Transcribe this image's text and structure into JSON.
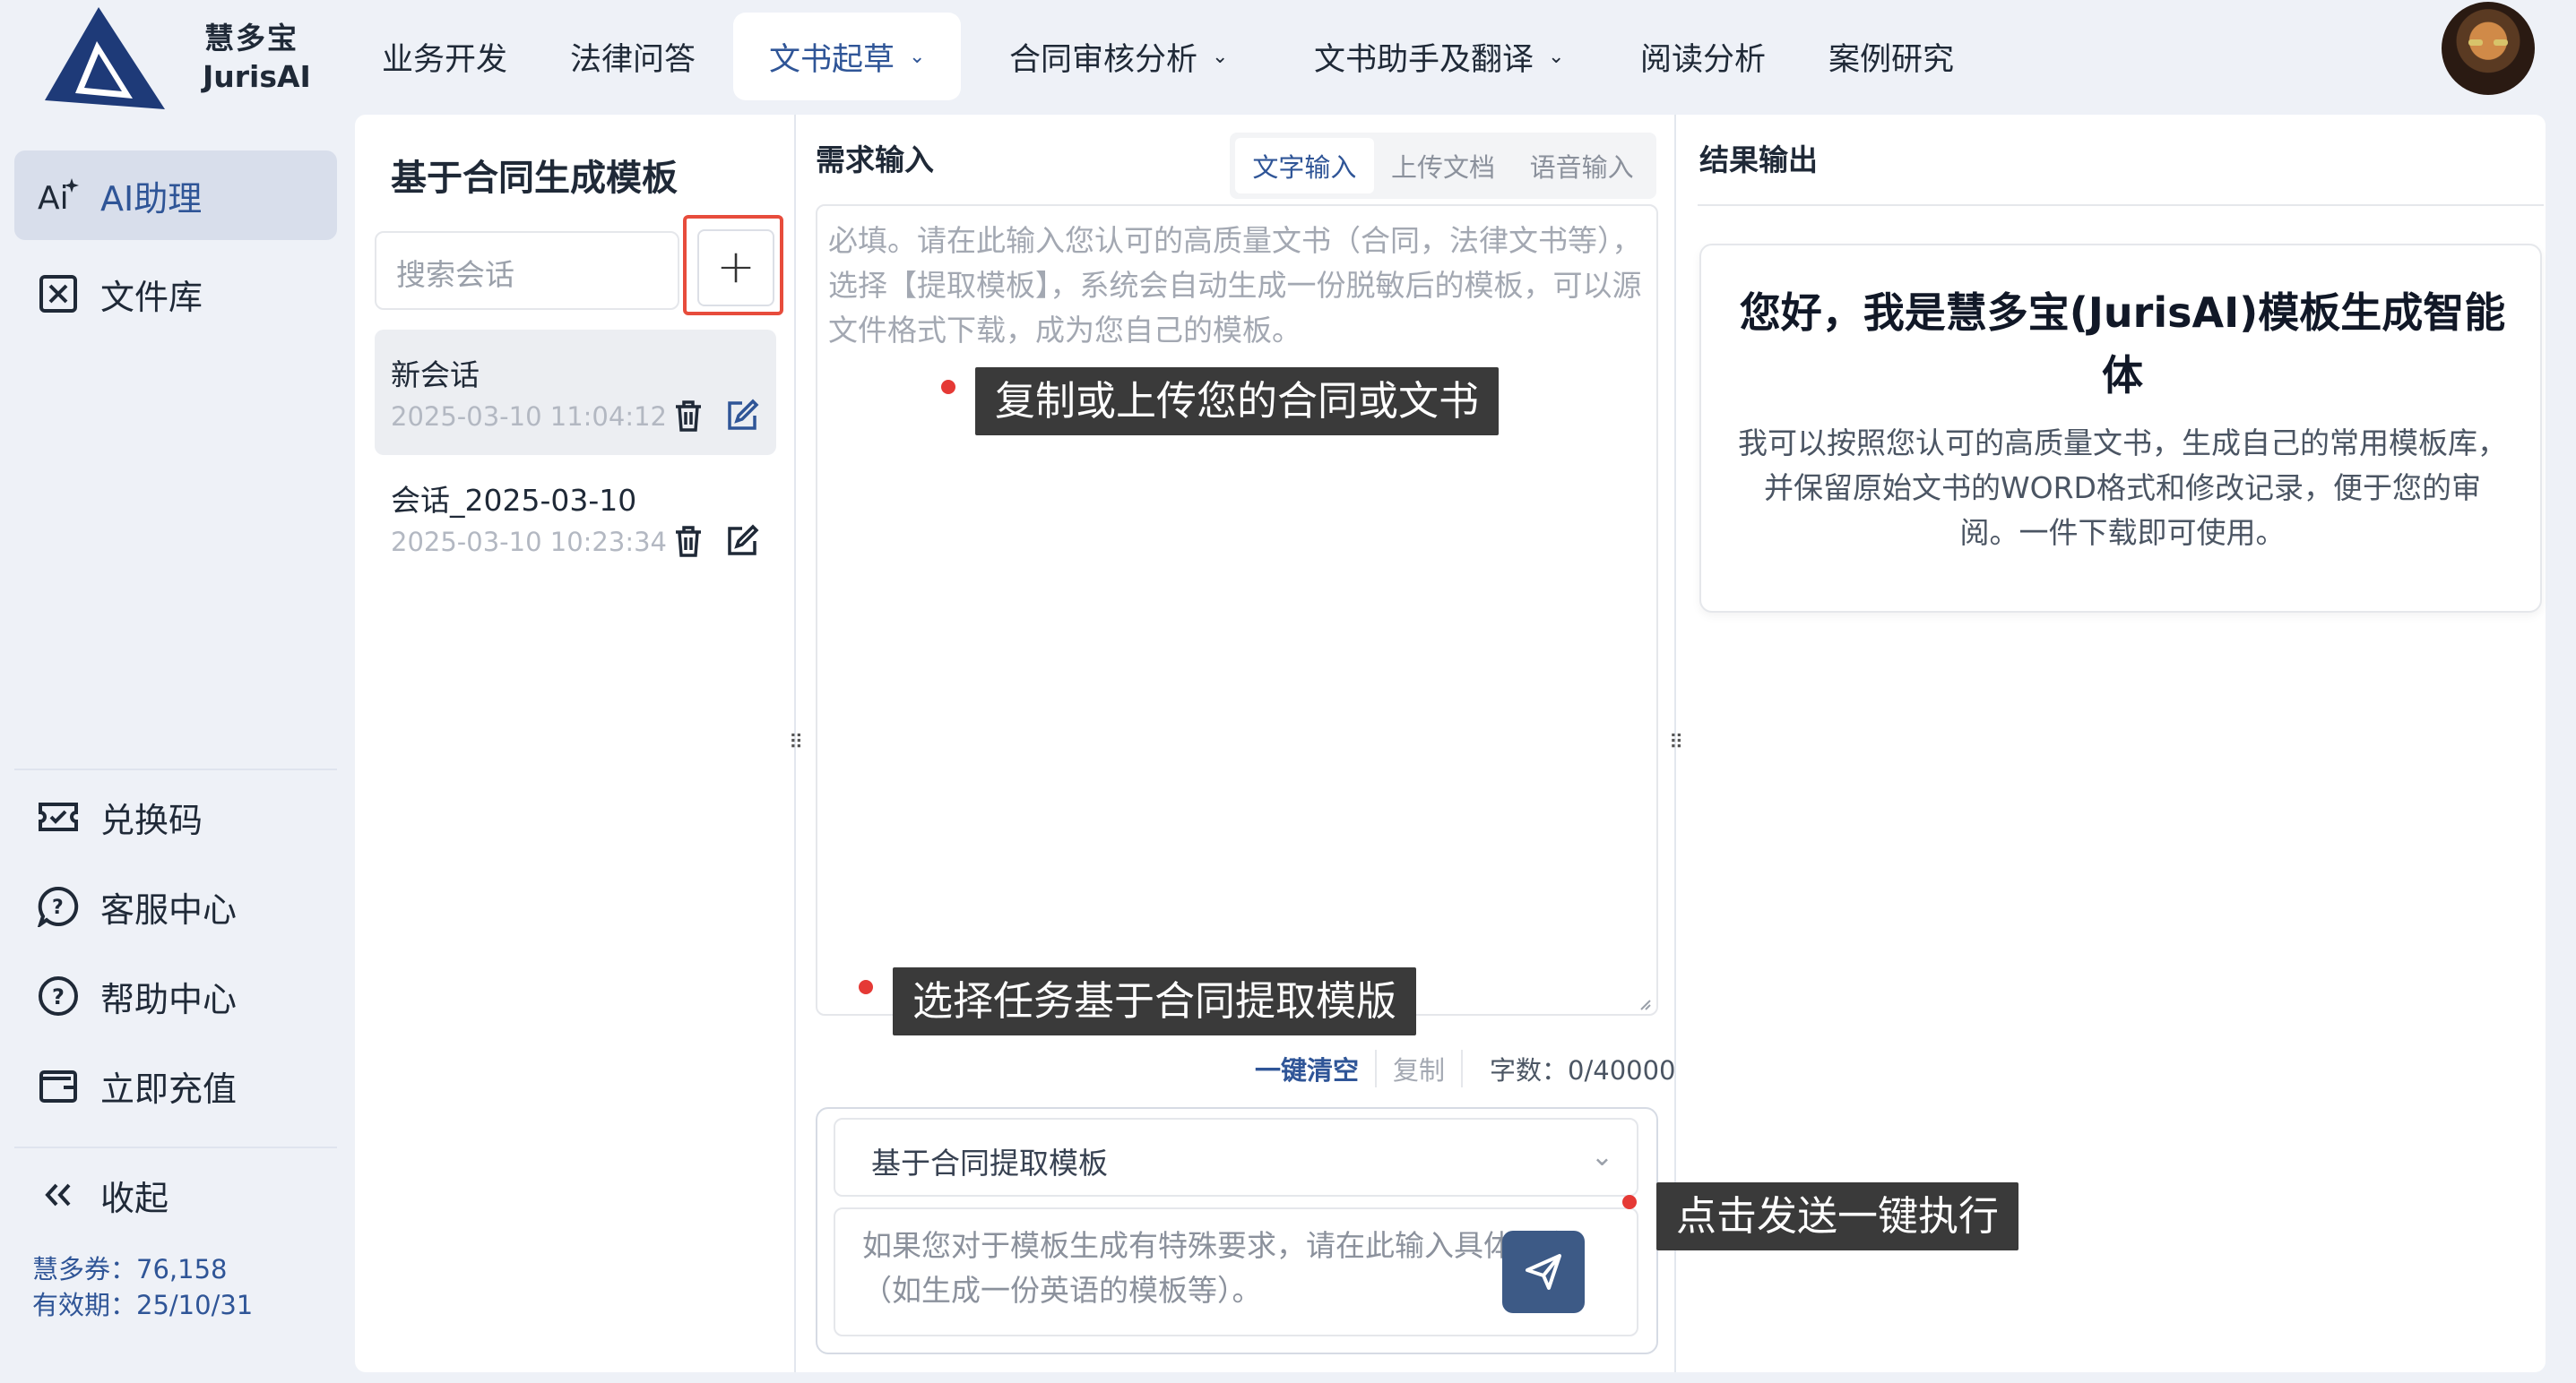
{
  "brand": {
    "name_cn": "慧多宝",
    "name_en": "JurisAI"
  },
  "nav": [
    {
      "label": "业务开发"
    },
    {
      "label": "法律问答"
    },
    {
      "label": "文书起草",
      "active": true,
      "has_dropdown": true
    },
    {
      "label": "合同审核分析",
      "has_dropdown": true
    },
    {
      "label": "文书助手及翻译",
      "has_dropdown": true
    },
    {
      "label": "阅读分析"
    },
    {
      "label": "案例研究"
    }
  ],
  "sidebar": {
    "top_items": [
      {
        "label": "AI助理",
        "icon": "ai-sparkle-icon",
        "active": true
      },
      {
        "label": "文件库",
        "icon": "file-library-icon"
      }
    ],
    "bottom_items": [
      {
        "label": "兑换码",
        "icon": "ticket-icon"
      },
      {
        "label": "客服中心",
        "icon": "chat-support-icon"
      },
      {
        "label": "帮助中心",
        "icon": "question-circle-icon"
      },
      {
        "label": "立即充值",
        "icon": "wallet-icon"
      }
    ],
    "collapse_label": "收起",
    "coupon_text": "慧多券：76,158",
    "expiry_text": "有效期：25/10/31"
  },
  "sessions_panel": {
    "title": "基于合同生成模板",
    "search_placeholder": "搜索会话",
    "sessions": [
      {
        "name": "新会话",
        "time": "2025-03-10 11:04:12",
        "active": true
      },
      {
        "name": "会话_2025-03-10",
        "time": "2025-03-10 10:23:34"
      }
    ]
  },
  "input_panel": {
    "title": "需求输入",
    "tabs": [
      {
        "label": "文字输入",
        "active": true
      },
      {
        "label": "上传文档"
      },
      {
        "label": "语音输入"
      }
    ],
    "textarea_placeholder": "必填。请在此输入您认可的高质量文书（合同，法律文书等），选择【提取模板】，系统会自动生成一份脱敏后的模板，可以源文件格式下载，成为您自己的模板。",
    "clear_label": "一键清空",
    "copy_label": "复制",
    "count_text": "字数：0/40000",
    "task_select": "基于合同提取模板",
    "extra_placeholder": "如果您对于模板生成有特殊要求，请在此输入具体信息（如生成一份英语的模板等）。"
  },
  "output_panel": {
    "title": "结果输出",
    "greeting_title": "您好，我是慧多宝(JurisAI)模板生成智能体",
    "greeting_body": "我可以按照您认可的高质量文书，生成自己的常用模板库，并保留原始文书的WORD格式和修改记录，便于您的审阅。一件下载即可使用。"
  },
  "annotations": {
    "tip1": "复制或上传您的合同或文书",
    "tip2": "选择任务基于合同提取模版",
    "tip3": "点击发送一键执行"
  },
  "colors": {
    "accent": "#2f5597",
    "highlight": "#e74c3c",
    "tooltip_bg": "#3a3a3a",
    "send_button": "#3d5a86"
  }
}
